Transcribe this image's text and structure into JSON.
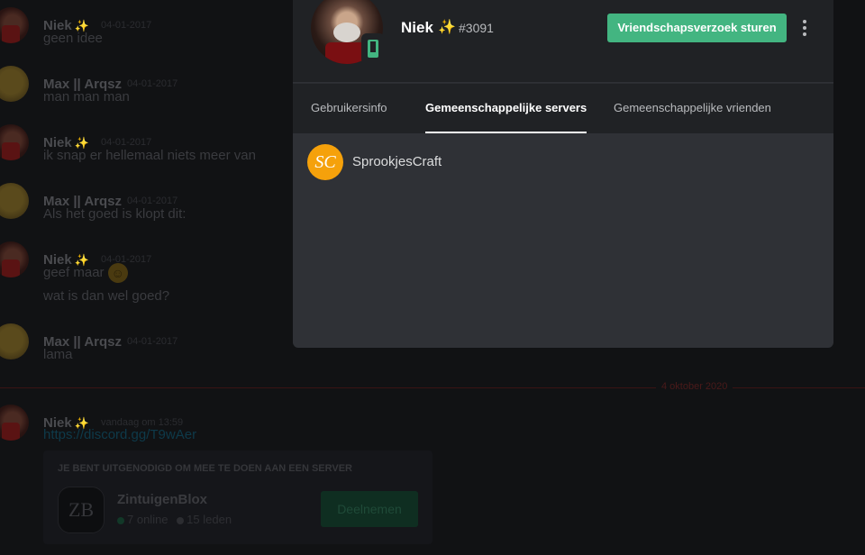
{
  "chat": {
    "messages": [
      {
        "author": "Niek",
        "badge": "✨",
        "date": "04-01-2017",
        "lines": [
          "geen idee"
        ]
      },
      {
        "author": "Max || Arqsz",
        "badge": "",
        "date": "04-01-2017",
        "lines": [
          "man man man"
        ]
      },
      {
        "author": "Niek",
        "badge": "✨",
        "date": "04-01-2017",
        "lines": [
          "ik snap er hellemaal niets meer van"
        ]
      },
      {
        "author": "Max || Arqsz",
        "badge": "",
        "date": "04-01-2017",
        "lines": [
          "Als het goed is klopt dit:"
        ]
      },
      {
        "author": "Niek",
        "badge": "✨",
        "date": "04-01-2017",
        "lines": [
          "geef maar",
          "wat is dan wel goed?"
        ]
      },
      {
        "author": "Max || Arqsz",
        "badge": "",
        "date": "04-01-2017",
        "lines": [
          "lama"
        ]
      },
      {
        "author": "Niek",
        "badge": "✨",
        "date": "vandaag om 13:59",
        "lines": []
      }
    ],
    "divider_date": "4 oktober 2020",
    "invite_link": "https://discord.gg/T9wAer",
    "invite": {
      "heading": "JE BENT UITGENODIGD OM MEE TE DOEN AAN EEN SERVER",
      "icon_text": "ZB",
      "server_name": "ZintuigenBlox",
      "online": "7 online",
      "members": "15 leden",
      "join_label": "Deelnemen"
    }
  },
  "profile": {
    "username": "Niek",
    "badge": "✨",
    "discriminator": "#3091",
    "friend_request_label": "Vriendschapsverzoek sturen",
    "tabs": [
      {
        "label": "Gebruikersinfo",
        "active": false
      },
      {
        "label": "Gemeenschappelijke servers",
        "active": true
      },
      {
        "label": "Gemeenschappelijke vrienden",
        "active": false
      }
    ],
    "servers": [
      {
        "name": "SprookjesCraft",
        "icon_text": "SC",
        "icon_color": "#f5a10b"
      }
    ],
    "status": "mobile-online",
    "accent_color": "#43b581"
  }
}
